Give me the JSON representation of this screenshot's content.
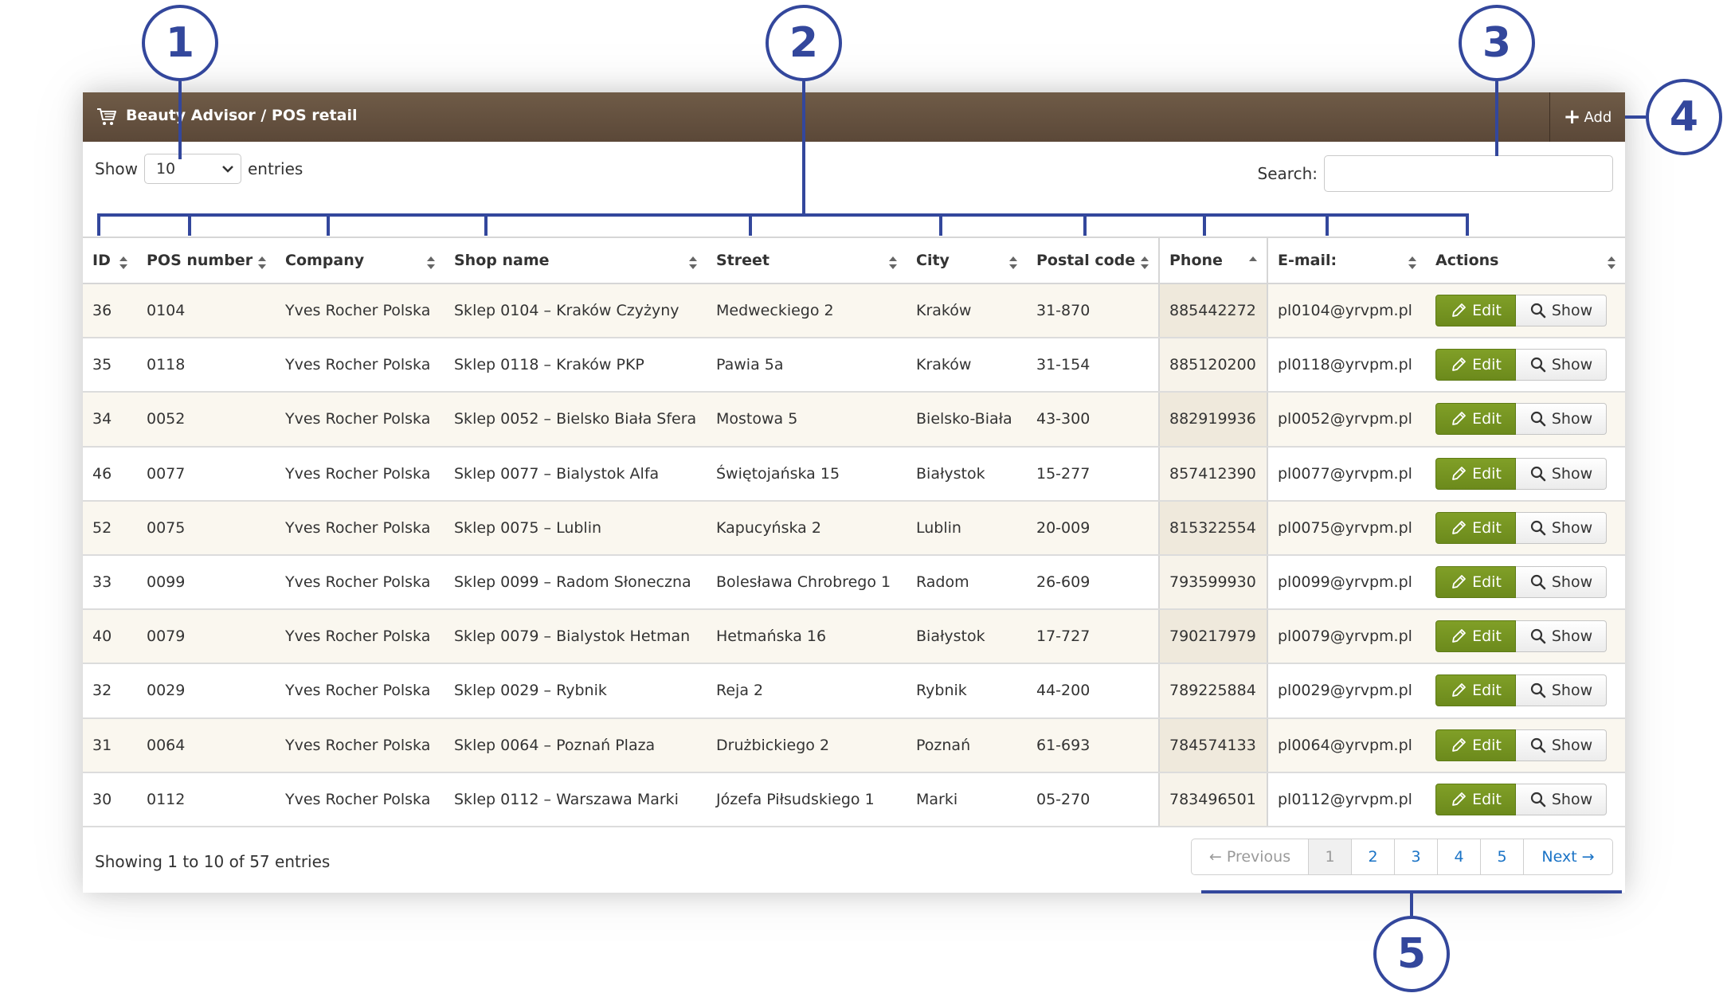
{
  "panel": {
    "title": "Beauty Advisor / POS retail",
    "add_label": "Add"
  },
  "length": {
    "prefix": "Show",
    "value": "10",
    "suffix": "entries"
  },
  "search": {
    "label": "Search:",
    "value": "",
    "placeholder": ""
  },
  "table": {
    "headers": [
      "ID",
      "POS number",
      "Company",
      "Shop name",
      "Street",
      "City",
      "Postal code",
      "Phone",
      "E-mail:",
      "Actions"
    ],
    "sort_states": [
      "both",
      "both",
      "both",
      "both",
      "both",
      "both",
      "both",
      "asc",
      "both",
      "both"
    ],
    "rows": [
      {
        "id": "36",
        "pos": "0104",
        "company": "Yves Rocher Polska",
        "shop": "Sklep 0104 – Kraków Czyżyny",
        "street": "Medweckiego 2",
        "city": "Kraków",
        "postal": "31-870",
        "phone": "885442272",
        "email": "pl0104@yrvpm.pl"
      },
      {
        "id": "35",
        "pos": "0118",
        "company": "Yves Rocher Polska",
        "shop": "Sklep 0118 – Kraków PKP",
        "street": "Pawia 5a",
        "city": "Kraków",
        "postal": "31-154",
        "phone": "885120200",
        "email": "pl0118@yrvpm.pl"
      },
      {
        "id": "34",
        "pos": "0052",
        "company": "Yves Rocher Polska",
        "shop": "Sklep 0052 – Bielsko Biała Sfera",
        "street": "Mostowa 5",
        "city": "Bielsko-Biała",
        "postal": "43-300",
        "phone": "882919936",
        "email": "pl0052@yrvpm.pl"
      },
      {
        "id": "46",
        "pos": "0077",
        "company": "Yves Rocher Polska",
        "shop": "Sklep 0077 – Bialystok Alfa",
        "street": "Świętojańska 15",
        "city": "Białystok",
        "postal": "15-277",
        "phone": "857412390",
        "email": "pl0077@yrvpm.pl"
      },
      {
        "id": "52",
        "pos": "0075",
        "company": "Yves Rocher Polska",
        "shop": "Sklep 0075 – Lublin",
        "street": "Kapucyńska 2",
        "city": "Lublin",
        "postal": "20-009",
        "phone": "815322554",
        "email": "pl0075@yrvpm.pl"
      },
      {
        "id": "33",
        "pos": "0099",
        "company": "Yves Rocher Polska",
        "shop": "Sklep 0099 – Radom Słoneczna",
        "street": "Bolesława Chrobrego 1",
        "city": "Radom",
        "postal": "26-609",
        "phone": "793599930",
        "email": "pl0099@yrvpm.pl"
      },
      {
        "id": "40",
        "pos": "0079",
        "company": "Yves Rocher Polska",
        "shop": "Sklep 0079 – Bialystok Hetman",
        "street": "Hetmańska 16",
        "city": "Białystok",
        "postal": "17-727",
        "phone": "790217979",
        "email": "pl0079@yrvpm.pl"
      },
      {
        "id": "32",
        "pos": "0029",
        "company": "Yves Rocher Polska",
        "shop": "Sklep 0029 – Rybnik",
        "street": "Reja 2",
        "city": "Rybnik",
        "postal": "44-200",
        "phone": "789225884",
        "email": "pl0029@yrvpm.pl"
      },
      {
        "id": "31",
        "pos": "0064",
        "company": "Yves Rocher Polska",
        "shop": "Sklep 0064 – Poznań Plaza",
        "street": "Drużbickiego 2",
        "city": "Poznań",
        "postal": "61-693",
        "phone": "784574133",
        "email": "pl0064@yrvpm.pl"
      },
      {
        "id": "30",
        "pos": "0112",
        "company": "Yves Rocher Polska",
        "shop": "Sklep 0112 – Warszawa Marki",
        "street": "Józefa Piłsudskiego 1",
        "city": "Marki",
        "postal": "05-270",
        "phone": "783496501",
        "email": "pl0112@yrvpm.pl"
      }
    ],
    "edit_label": "Edit",
    "show_label": "Show"
  },
  "footer": {
    "info": "Showing 1 to 10 of 57 entries",
    "pages": [
      {
        "label": "← Previous",
        "state": "disabled"
      },
      {
        "label": "1",
        "state": "current"
      },
      {
        "label": "2",
        "state": "normal"
      },
      {
        "label": "3",
        "state": "normal"
      },
      {
        "label": "4",
        "state": "normal"
      },
      {
        "label": "5",
        "state": "normal"
      },
      {
        "label": "Next →",
        "state": "normal"
      }
    ]
  },
  "callouts": [
    "1",
    "2",
    "3",
    "4",
    "5"
  ],
  "icons": {
    "cart": "shopping-cart-icon",
    "add": "plus-icon",
    "edit": "pencil-icon",
    "show": "magnifier-icon",
    "sort": "sort-icon",
    "select": "chevron-down-icon"
  },
  "colors": {
    "header_brown": "#5b4838",
    "edit_green": "#6c8a1c",
    "callout_blue": "#33479c",
    "link_blue": "#1a73c6"
  }
}
